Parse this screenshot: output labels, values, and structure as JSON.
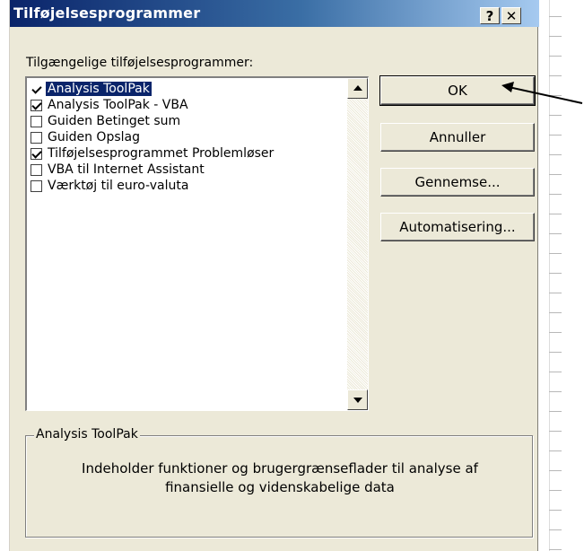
{
  "dialog": {
    "title": "Tilføjelsesprogrammer",
    "help_label": "?",
    "close_label": "✕"
  },
  "addins": {
    "label": "Tilgængelige tilføjelsesprogrammer:",
    "items": [
      {
        "label": "Analysis ToolPak",
        "checked": true,
        "selected": true
      },
      {
        "label": "Analysis ToolPak - VBA",
        "checked": true,
        "selected": false
      },
      {
        "label": "Guiden Betinget sum",
        "checked": false,
        "selected": false
      },
      {
        "label": "Guiden Opslag",
        "checked": false,
        "selected": false
      },
      {
        "label": "Tilføjelsesprogrammet Problemløser",
        "checked": true,
        "selected": false
      },
      {
        "label": "VBA til Internet Assistant",
        "checked": false,
        "selected": false
      },
      {
        "label": "Værktøj til euro-valuta",
        "checked": false,
        "selected": false
      }
    ]
  },
  "buttons": {
    "ok": "OK",
    "cancel": "Annuller",
    "browse": "Gennemse...",
    "automation": "Automatisering..."
  },
  "description": {
    "group_title": "Analysis ToolPak",
    "line1": "Indeholder funktioner og brugergrænseflader til analyse af",
    "line2": "finansielle og videnskabelige data"
  },
  "icons": {
    "scroll_up": "scroll-up-arrow-icon",
    "scroll_down": "scroll-down-arrow-icon",
    "pointer": "annotation-arrow-icon"
  },
  "colors": {
    "titlebar_start": "#0a246a",
    "titlebar_end": "#a6caf0",
    "dialog_bg": "#ece9d8",
    "selection": "#0a246a"
  }
}
